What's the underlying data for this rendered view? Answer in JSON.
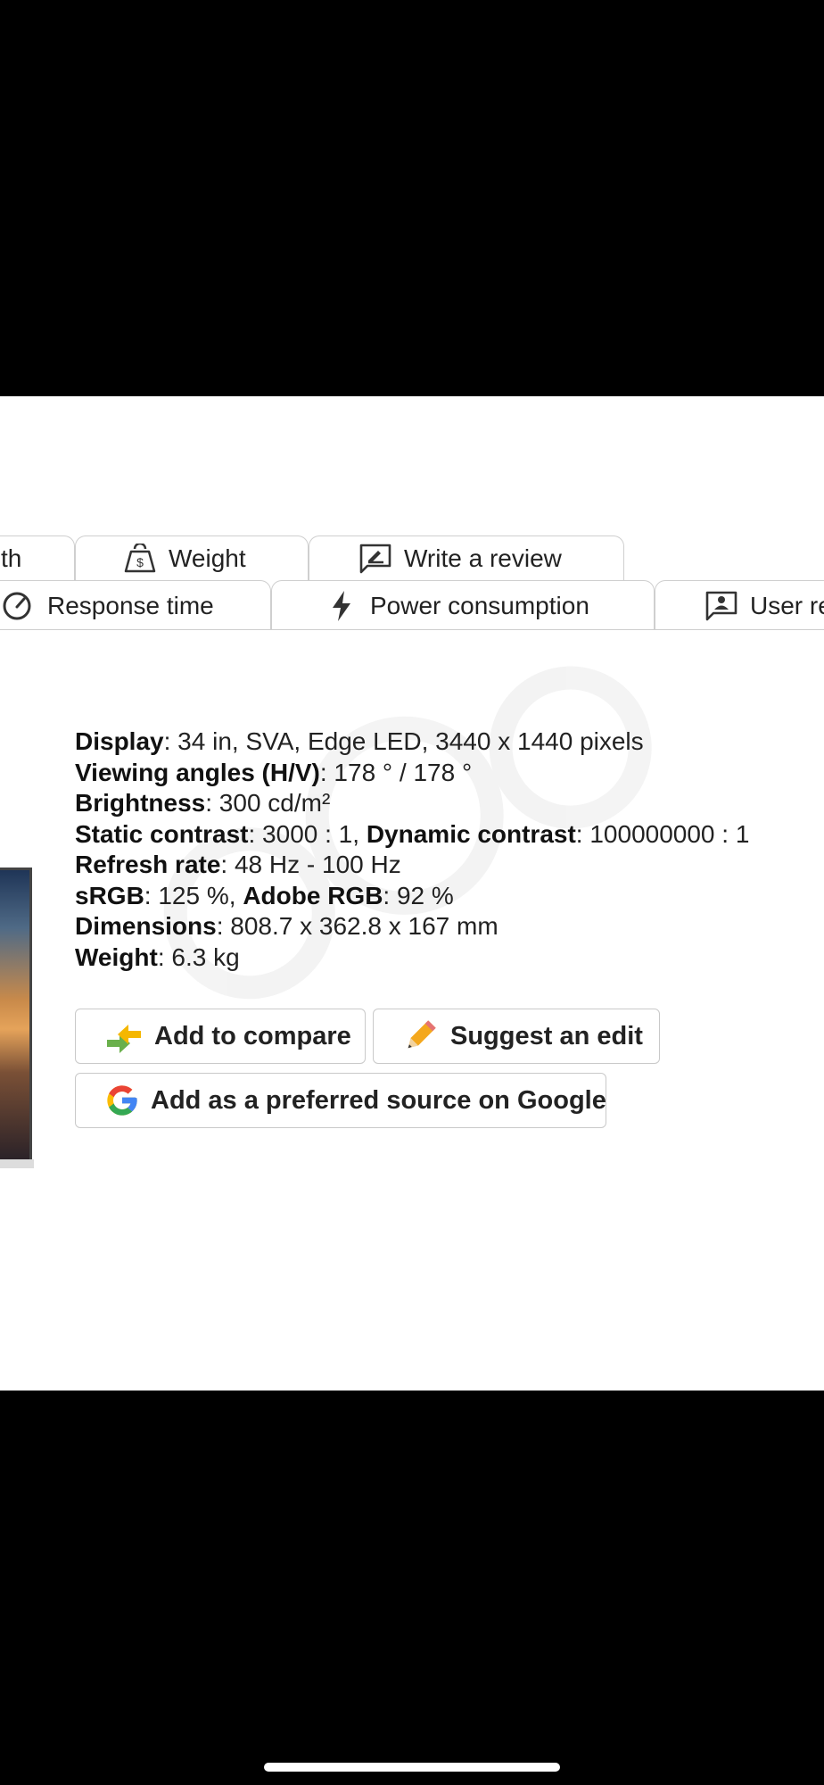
{
  "tabs": {
    "row1": [
      {
        "label": "th",
        "icon": "cut-off"
      },
      {
        "label": "Weight",
        "icon": "weight-icon"
      },
      {
        "label": "Write a review",
        "icon": "write-review-icon"
      }
    ],
    "row2": [
      {
        "label": "Response time",
        "icon": "gauge-icon"
      },
      {
        "label": "Power consumption",
        "icon": "lightning-icon"
      },
      {
        "label": "User re",
        "icon": "user-review-icon"
      }
    ]
  },
  "specs": {
    "display_label": "Display",
    "display_value": ": 34 in, SVA, Edge LED, 3440 x 1440 pixels",
    "viewing_label": "Viewing angles (H/V)",
    "viewing_value": ": 178 ° / 178 °",
    "brightness_label": "Brightness",
    "brightness_value": ": 300 cd/m²",
    "static_contrast_label": "Static contrast",
    "static_contrast_value": ": 3000 : 1, ",
    "dynamic_contrast_label": "Dynamic contrast",
    "dynamic_contrast_value": ": 100000000 : 1",
    "refresh_label": "Refresh rate",
    "refresh_value": ": 48 Hz - 100 Hz",
    "srgb_label": "sRGB",
    "srgb_value": ": 125 %, ",
    "adobe_label": "Adobe RGB",
    "adobe_value": ": 92 %",
    "dimensions_label": "Dimensions",
    "dimensions_value": ": 808.7 x 362.8 x 167 mm",
    "weight_label": "Weight",
    "weight_value": ": 6.3 kg"
  },
  "buttons": {
    "compare": "Add to compare",
    "suggest_edit": "Suggest an edit",
    "google_source": "Add as a preferred source on Google"
  },
  "colors": {
    "google_blue": "#4285F4",
    "google_red": "#EA4335",
    "google_yellow": "#FBBC05",
    "google_green": "#34A853",
    "compare_green": "#6ab04c",
    "compare_yellow": "#f5b700",
    "pencil_orange": "#f4a81d"
  }
}
